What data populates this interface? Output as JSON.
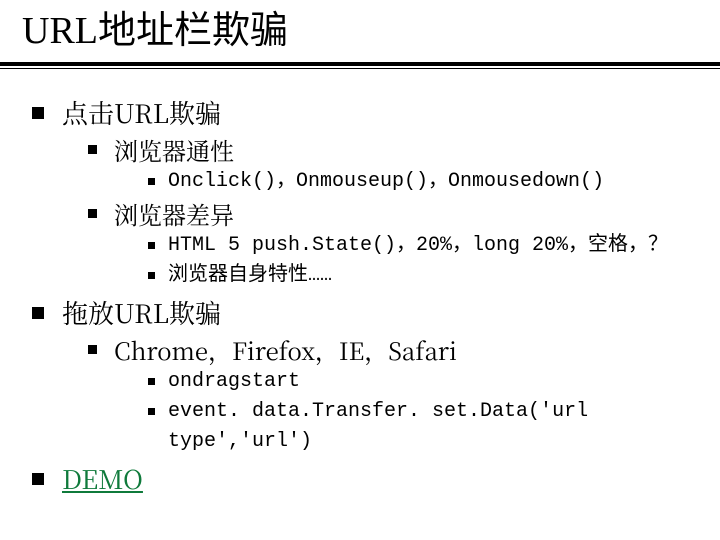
{
  "title": "URL地址栏欺骗",
  "items": [
    {
      "text": "点击URL欺骗",
      "children": [
        {
          "text": "浏览器通性",
          "children": [
            {
              "text": "Onclick()，Onmouseup()，Onmousedown()"
            }
          ]
        },
        {
          "text": "浏览器差异",
          "children": [
            {
              "text": "HTML 5 push.State()，20%，long 20%，空格，？"
            },
            {
              "text": "浏览器自身特性……"
            }
          ]
        }
      ]
    },
    {
      "text": "拖放URL欺骗",
      "children": [
        {
          "text": "Chrome，Firefox，IE，Safari",
          "children": [
            {
              "text": "ondragstart"
            },
            {
              "text": "event. data.Transfer. set.Data('url type','url')"
            }
          ]
        }
      ]
    },
    {
      "text": "DEMO",
      "link": true
    }
  ]
}
